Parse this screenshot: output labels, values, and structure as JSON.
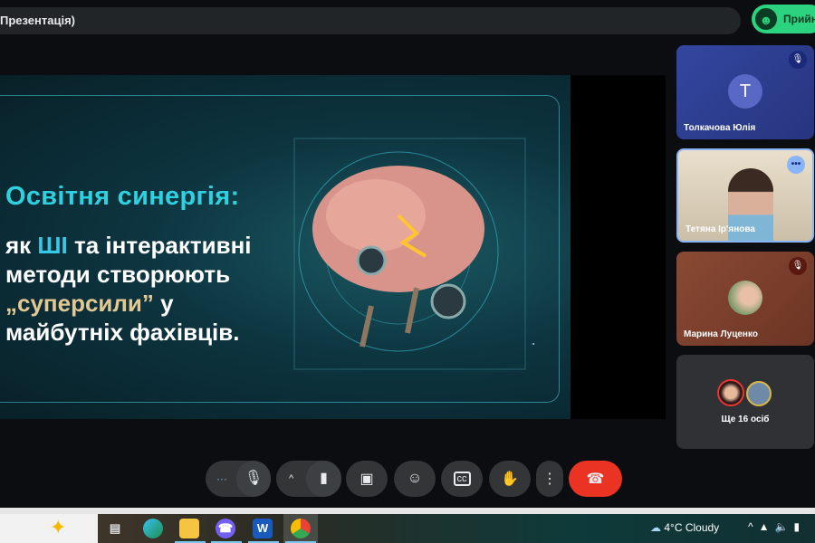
{
  "header": {
    "title": "Презентація)",
    "accept_label": "Прийня"
  },
  "slide": {
    "title": "Освітня синергія:",
    "line1_pre": "як ",
    "line1_hl": "ШІ",
    "line1_post": " та інтерактивні",
    "line2": "методи створюють",
    "line3_hl": "„суперсили”",
    "line3_post": " у",
    "line4": "майбутніх фахівців."
  },
  "participants": [
    {
      "name": "Толкачова Юлія",
      "initial": "T",
      "muted": true
    },
    {
      "name": "Тетяна Ір'янова",
      "muted": false
    },
    {
      "name": "Марина Луценко",
      "muted": true
    }
  ],
  "more": {
    "label": "Ще 16 осіб"
  },
  "controls": {
    "more_dots": "···",
    "arrow": "^"
  },
  "taskbar": {
    "weather": "4°C  Cloudy"
  },
  "colors": {
    "accept": "#2bd37e",
    "end_call": "#ea3323",
    "tile1": "#2c3d8f",
    "tile3": "#7a3e2c"
  }
}
